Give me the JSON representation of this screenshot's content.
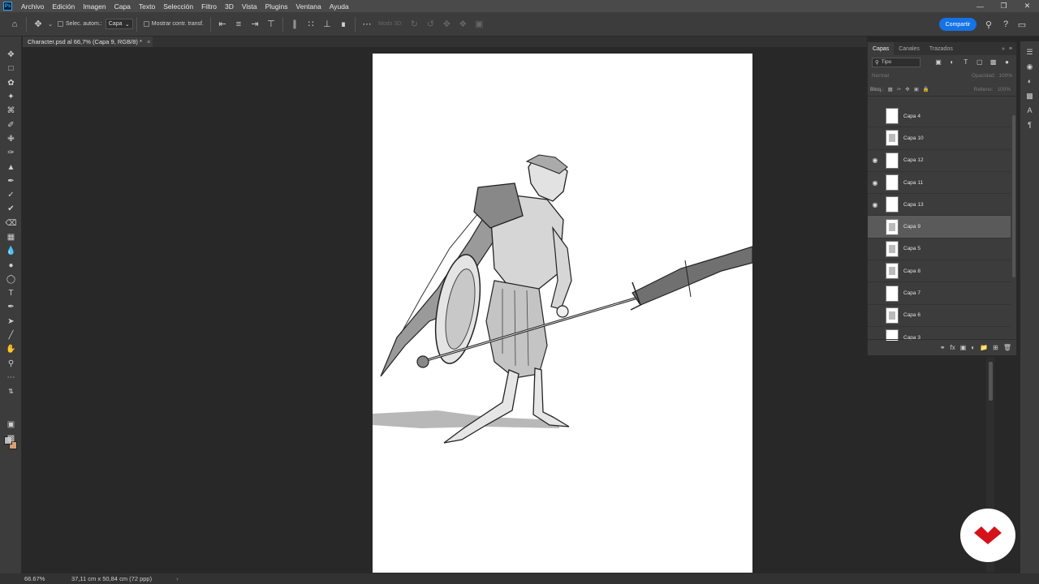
{
  "app": {
    "logo": "Ps"
  },
  "menu": [
    "Archivo",
    "Edición",
    "Imagen",
    "Capa",
    "Texto",
    "Selección",
    "Filtro",
    "3D",
    "Vista",
    "Plugins",
    "Ventana",
    "Ayuda"
  ],
  "options": {
    "auto_select_label": "Selec. autom.:",
    "auto_select_target": "Capa",
    "show_transform_label": "Mostrar contr. transf.",
    "mode3d_label": "Modo 3D:",
    "share_label": "Compartir"
  },
  "document": {
    "tab_title": "Character.psd al 66,7% (Capa 9, RGB/8) *"
  },
  "status": {
    "zoom": "66.67%",
    "doc_size": "37,11 cm x 50,84 cm (72 ppp)"
  },
  "layers_panel": {
    "tabs": [
      "Capas",
      "Canales",
      "Trazados"
    ],
    "filter_label": "Tipo",
    "blend_mode": "Normal",
    "opacity_label": "Opacidad:",
    "opacity_value": "100%",
    "lock_label": "Bloq.:",
    "fill_label": "Relleno:",
    "fill_value": "100%",
    "layers": [
      {
        "name": "Capa 4",
        "visible": false,
        "selected": false
      },
      {
        "name": "Capa 10",
        "visible": false,
        "selected": false
      },
      {
        "name": "Capa 12",
        "visible": true,
        "selected": false
      },
      {
        "name": "Capa 11",
        "visible": true,
        "selected": false
      },
      {
        "name": "Capa 13",
        "visible": true,
        "selected": false
      },
      {
        "name": "Capa 9",
        "visible": false,
        "selected": true
      },
      {
        "name": "Capa 5",
        "visible": false,
        "selected": false
      },
      {
        "name": "Capa 8",
        "visible": false,
        "selected": false
      },
      {
        "name": "Capa 7",
        "visible": false,
        "selected": false
      },
      {
        "name": "Capa 6",
        "visible": false,
        "selected": false
      },
      {
        "name": "Capa 3",
        "visible": false,
        "selected": false
      }
    ]
  },
  "colors": {
    "accent": "#1473e6",
    "brand_red": "#d5121a",
    "foreground": "#b8b8b8",
    "background": "#d4a070"
  }
}
